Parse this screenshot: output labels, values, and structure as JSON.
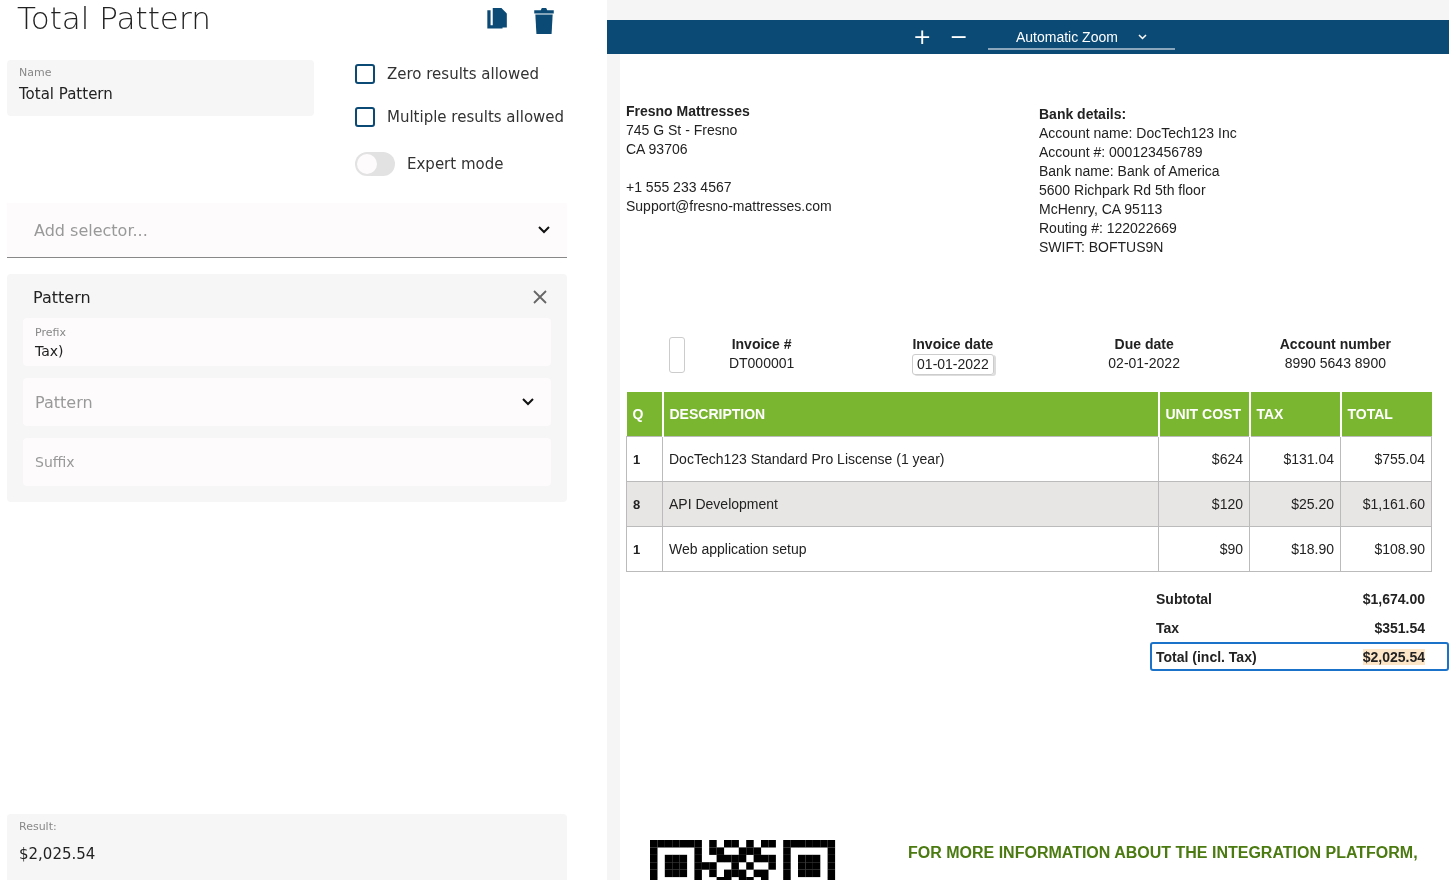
{
  "editor": {
    "title": "Total Pattern",
    "name_field": {
      "label": "Name",
      "value": "Total Pattern"
    },
    "options": [
      {
        "label": "Zero results allowed",
        "checked": false
      },
      {
        "label": "Multiple results allowed",
        "checked": false
      }
    ],
    "expert_mode": {
      "label": "Expert mode",
      "on": false
    },
    "add_selector": {
      "placeholder": "Add selector..."
    },
    "pattern_card": {
      "title": "Pattern",
      "prefix": {
        "label": "Prefix",
        "value": "Tax)"
      },
      "pattern": {
        "placeholder": "Pattern"
      },
      "suffix": {
        "placeholder": "Suffix"
      }
    },
    "result": {
      "label": "Result:",
      "value": "$2,025.54"
    }
  },
  "viewer": {
    "toolbar": {
      "zoom_in": "+",
      "zoom_out": "−",
      "zoom_select": "Automatic Zoom"
    },
    "document": {
      "seller": {
        "name": "Fresno Mattresses",
        "address": [
          "745 G St - Fresno",
          "CA 93706"
        ],
        "contact": [
          "+1 555 233 4567",
          "Support@fresno-mattresses.com"
        ]
      },
      "bank": {
        "title": "Bank details:",
        "lines": [
          "Account name: DocTech123 Inc",
          "Account #: 000123456789",
          "Bank name: Bank of America",
          "5600 Richpark Rd 5th floor",
          "McHenry, CA 95113",
          "Routing #: 122022669",
          "SWIFT: BOFTUS9N"
        ]
      },
      "meta": [
        {
          "label": "Invoice #",
          "value": "DT000001",
          "marker": true,
          "boxed": false
        },
        {
          "label": "Invoice date",
          "value": "01-01-2022",
          "marker": false,
          "boxed": true
        },
        {
          "label": "Due date",
          "value": "02-01-2022",
          "marker": false,
          "boxed": false
        },
        {
          "label": "Account number",
          "value": "8990 5643 8900",
          "marker": false,
          "boxed": false
        }
      ],
      "table": {
        "columns": [
          "Q",
          "DESCRIPTION",
          "UNIT COST",
          "TAX",
          "TOTAL"
        ],
        "rows": [
          [
            "1",
            "DocTech123 Standard Pro Liscense (1 year)",
            "$624",
            "$131.04",
            "$755.04"
          ],
          [
            "8",
            "API Development",
            "$120",
            "$25.20",
            "$1,161.60"
          ],
          [
            "1",
            "Web application setup",
            "$90",
            "$18.90",
            "$108.90"
          ]
        ]
      },
      "totals": [
        {
          "label": "Subtotal",
          "value": "$1,674.00",
          "selected": false
        },
        {
          "label": "Tax",
          "value": "$351.54",
          "selected": false
        },
        {
          "label": "Total (incl. Tax)",
          "value": "$2,025.54",
          "selected": true
        }
      ],
      "footer_text": "FOR MORE INFORMATION ABOUT THE INTEGRATION PLATFORM,"
    }
  }
}
